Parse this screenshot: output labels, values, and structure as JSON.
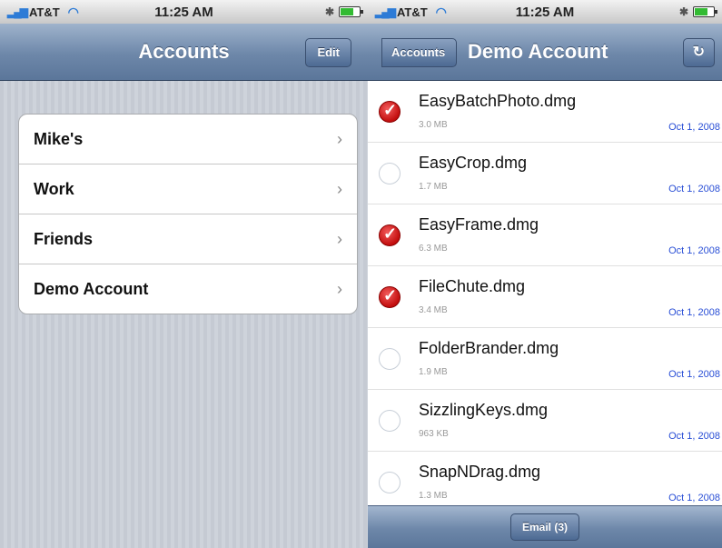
{
  "left": {
    "status": {
      "carrier": "AT&T",
      "time": "11:25 AM"
    },
    "nav": {
      "title": "Accounts",
      "edit_label": "Edit"
    },
    "accounts": [
      {
        "label": "Mike's"
      },
      {
        "label": "Work"
      },
      {
        "label": "Friends"
      },
      {
        "label": "Demo Account"
      }
    ]
  },
  "right": {
    "status": {
      "carrier": "AT&T",
      "time": "11:25 AM"
    },
    "nav": {
      "back_label": "Accounts",
      "title": "Demo Account",
      "refresh_icon": "refresh-icon"
    },
    "files": [
      {
        "name": "EasyBatchPhoto.dmg",
        "size": "3.0 MB",
        "date": "Oct 1, 2008",
        "checked": true
      },
      {
        "name": "EasyCrop.dmg",
        "size": "1.7 MB",
        "date": "Oct 1, 2008",
        "checked": false
      },
      {
        "name": "EasyFrame.dmg",
        "size": "6.3 MB",
        "date": "Oct 1, 2008",
        "checked": true
      },
      {
        "name": "FileChute.dmg",
        "size": "3.4 MB",
        "date": "Oct 1, 2008",
        "checked": true
      },
      {
        "name": "FolderBrander.dmg",
        "size": "1.9 MB",
        "date": "Oct 1, 2008",
        "checked": false
      },
      {
        "name": "SizzlingKeys.dmg",
        "size": "963 KB",
        "date": "Oct 1, 2008",
        "checked": false
      },
      {
        "name": "SnapNDrag.dmg",
        "size": "1.3 MB",
        "date": "Oct 1, 2008",
        "checked": false
      }
    ],
    "toolbar": {
      "email_label": "Email (3)"
    }
  },
  "colors": {
    "nav_blue": "#6d87a9",
    "check_red": "#c30e0e",
    "date_blue": "#2a4fd6"
  }
}
